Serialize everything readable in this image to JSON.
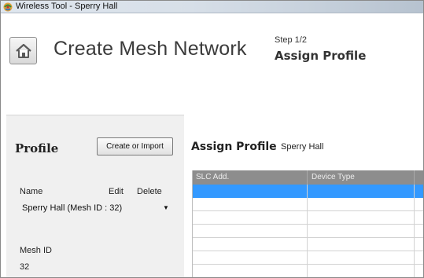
{
  "window": {
    "title": "Wireless Tool - Sperry Hall"
  },
  "header": {
    "title": "Create Mesh Network",
    "step_number": "Step 1/2",
    "step_label": "Assign Profile",
    "home_icon": "home-icon"
  },
  "profile_panel": {
    "heading": "Profile",
    "create_import_label": "Create or Import",
    "columns": {
      "name": "Name",
      "edit": "Edit",
      "delete": "Delete"
    },
    "selected_profile": "Sperry Hall (Mesh ID : 32)",
    "mesh_id_label": "Mesh ID",
    "mesh_id_value": "32"
  },
  "assign": {
    "title": "Assign Profile",
    "building": "Sperry Hall",
    "columns": [
      "SLC Add.",
      "Device Type"
    ],
    "rows": [
      {
        "selected": true
      },
      {
        "selected": false
      },
      {
        "selected": false
      },
      {
        "selected": false
      },
      {
        "selected": false
      },
      {
        "selected": false
      },
      {
        "selected": false
      }
    ]
  },
  "colors": {
    "selection": "#3399ff",
    "grid_header": "#8d8d8d",
    "panel_bg": "#f0f0f0"
  }
}
